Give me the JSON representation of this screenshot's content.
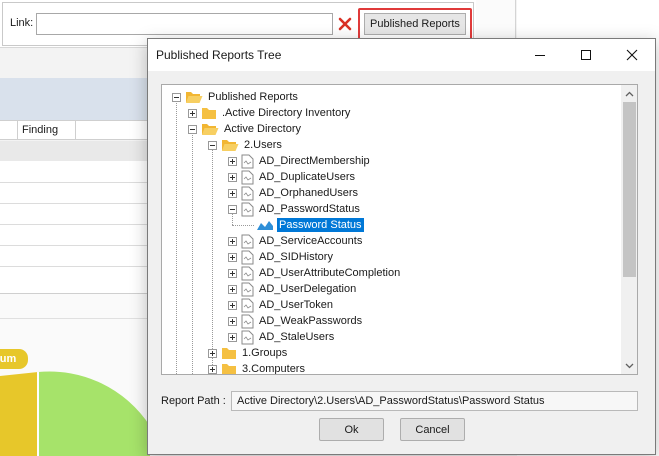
{
  "background": {
    "link_label": "Link:",
    "link_value": "",
    "published_reports_button": "Published Reports",
    "grid_header": "Finding",
    "badge_text": "dium",
    "colors": {
      "highlight": "#e03a3a",
      "chart_yellow": "#e7c72a",
      "chart_green": "#a6e36a"
    }
  },
  "dialog": {
    "title": "Published Reports Tree",
    "tree": {
      "root": "Published Reports",
      "items": [
        {
          "label": ".Active Directory Inventory",
          "icon": "folder-icon"
        },
        {
          "label": "Active Directory",
          "icon": "folder-open-icon"
        },
        {
          "label": "2.Users",
          "icon": "folder-open-icon"
        },
        {
          "label": "AD_DirectMembership",
          "icon": "report-file-icon"
        },
        {
          "label": "AD_DuplicateUsers",
          "icon": "report-file-icon"
        },
        {
          "label": "AD_OrphanedUsers",
          "icon": "report-file-icon"
        },
        {
          "label": "AD_PasswordStatus",
          "icon": "report-file-icon"
        },
        {
          "label": "Password Status",
          "icon": "chart-report-icon",
          "selected": true
        },
        {
          "label": "AD_ServiceAccounts",
          "icon": "report-file-icon"
        },
        {
          "label": "AD_SIDHistory",
          "icon": "report-file-icon"
        },
        {
          "label": "AD_UserAttributeCompletion",
          "icon": "report-file-icon"
        },
        {
          "label": "AD_UserDelegation",
          "icon": "report-file-icon"
        },
        {
          "label": "AD_UserToken",
          "icon": "report-file-icon"
        },
        {
          "label": "AD_WeakPasswords",
          "icon": "report-file-icon"
        },
        {
          "label": "AD_StaleUsers",
          "icon": "report-file-icon"
        },
        {
          "label": "1.Groups",
          "icon": "folder-icon"
        },
        {
          "label": "3.Computers",
          "icon": "folder-icon"
        }
      ]
    },
    "report_path_label": "Report Path :",
    "report_path_value": "Active Directory\\2.Users\\AD_PasswordStatus\\Password Status",
    "ok_label": "Ok",
    "cancel_label": "Cancel",
    "colors": {
      "selection": "#0078d7",
      "folder": "#f5c042"
    }
  }
}
